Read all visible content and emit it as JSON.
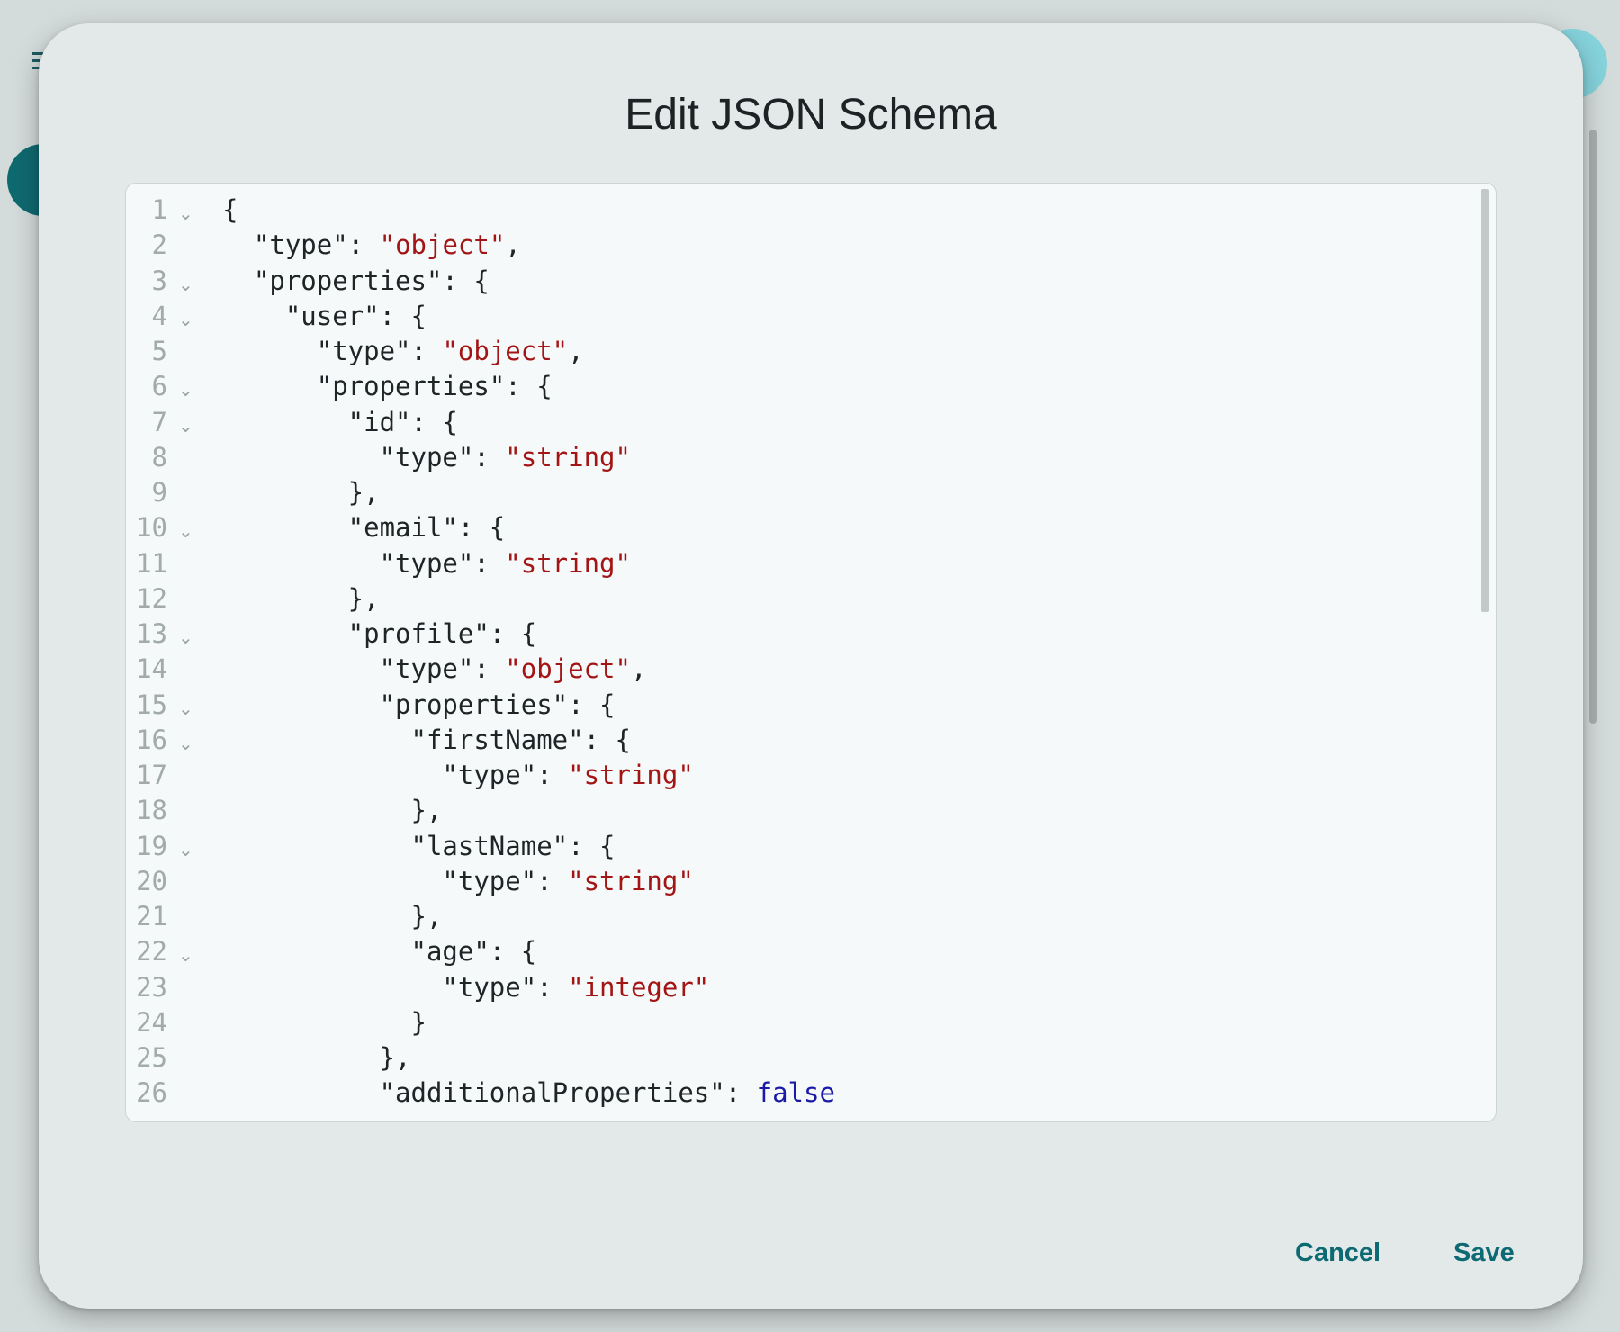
{
  "dialog": {
    "title": "Edit JSON Schema",
    "cancel_label": "Cancel",
    "save_label": "Save"
  },
  "colors": {
    "accent": "#0d6a72",
    "string": "#a31515",
    "keyword": "#1a1aa6"
  },
  "editor": {
    "lines": [
      {
        "num": "1",
        "foldable": true,
        "tokens": [
          {
            "t": "plain",
            "v": "{"
          }
        ]
      },
      {
        "num": "2",
        "foldable": false,
        "tokens": [
          {
            "t": "plain",
            "v": "  \"type\": "
          },
          {
            "t": "string",
            "v": "\"object\""
          },
          {
            "t": "plain",
            "v": ","
          }
        ]
      },
      {
        "num": "3",
        "foldable": true,
        "tokens": [
          {
            "t": "plain",
            "v": "  \"properties\": {"
          }
        ]
      },
      {
        "num": "4",
        "foldable": true,
        "tokens": [
          {
            "t": "plain",
            "v": "    \"user\": {"
          }
        ]
      },
      {
        "num": "5",
        "foldable": false,
        "tokens": [
          {
            "t": "plain",
            "v": "      \"type\": "
          },
          {
            "t": "string",
            "v": "\"object\""
          },
          {
            "t": "plain",
            "v": ","
          }
        ]
      },
      {
        "num": "6",
        "foldable": true,
        "tokens": [
          {
            "t": "plain",
            "v": "      \"properties\": {"
          }
        ]
      },
      {
        "num": "7",
        "foldable": true,
        "tokens": [
          {
            "t": "plain",
            "v": "        \"id\": {"
          }
        ]
      },
      {
        "num": "8",
        "foldable": false,
        "tokens": [
          {
            "t": "plain",
            "v": "          \"type\": "
          },
          {
            "t": "string",
            "v": "\"string\""
          }
        ]
      },
      {
        "num": "9",
        "foldable": false,
        "tokens": [
          {
            "t": "plain",
            "v": "        },"
          }
        ]
      },
      {
        "num": "10",
        "foldable": true,
        "tokens": [
          {
            "t": "plain",
            "v": "        \"email\": {"
          }
        ]
      },
      {
        "num": "11",
        "foldable": false,
        "tokens": [
          {
            "t": "plain",
            "v": "          \"type\": "
          },
          {
            "t": "string",
            "v": "\"string\""
          }
        ]
      },
      {
        "num": "12",
        "foldable": false,
        "tokens": [
          {
            "t": "plain",
            "v": "        },"
          }
        ]
      },
      {
        "num": "13",
        "foldable": true,
        "tokens": [
          {
            "t": "plain",
            "v": "        \"profile\": {"
          }
        ]
      },
      {
        "num": "14",
        "foldable": false,
        "tokens": [
          {
            "t": "plain",
            "v": "          \"type\": "
          },
          {
            "t": "string",
            "v": "\"object\""
          },
          {
            "t": "plain",
            "v": ","
          }
        ]
      },
      {
        "num": "15",
        "foldable": true,
        "tokens": [
          {
            "t": "plain",
            "v": "          \"properties\": {"
          }
        ]
      },
      {
        "num": "16",
        "foldable": true,
        "tokens": [
          {
            "t": "plain",
            "v": "            \"firstName\": {"
          }
        ]
      },
      {
        "num": "17",
        "foldable": false,
        "tokens": [
          {
            "t": "plain",
            "v": "              \"type\": "
          },
          {
            "t": "string",
            "v": "\"string\""
          }
        ]
      },
      {
        "num": "18",
        "foldable": false,
        "tokens": [
          {
            "t": "plain",
            "v": "            },"
          }
        ]
      },
      {
        "num": "19",
        "foldable": true,
        "tokens": [
          {
            "t": "plain",
            "v": "            \"lastName\": {"
          }
        ]
      },
      {
        "num": "20",
        "foldable": false,
        "tokens": [
          {
            "t": "plain",
            "v": "              \"type\": "
          },
          {
            "t": "string",
            "v": "\"string\""
          }
        ]
      },
      {
        "num": "21",
        "foldable": false,
        "tokens": [
          {
            "t": "plain",
            "v": "            },"
          }
        ]
      },
      {
        "num": "22",
        "foldable": true,
        "tokens": [
          {
            "t": "plain",
            "v": "            \"age\": {"
          }
        ]
      },
      {
        "num": "23",
        "foldable": false,
        "tokens": [
          {
            "t": "plain",
            "v": "              \"type\": "
          },
          {
            "t": "string",
            "v": "\"integer\""
          }
        ]
      },
      {
        "num": "24",
        "foldable": false,
        "tokens": [
          {
            "t": "plain",
            "v": "            }"
          }
        ]
      },
      {
        "num": "25",
        "foldable": false,
        "tokens": [
          {
            "t": "plain",
            "v": "          },"
          }
        ]
      },
      {
        "num": "26",
        "foldable": false,
        "tokens": [
          {
            "t": "plain",
            "v": "          \"additionalProperties\": "
          },
          {
            "t": "keyword",
            "v": "false"
          }
        ]
      }
    ]
  }
}
